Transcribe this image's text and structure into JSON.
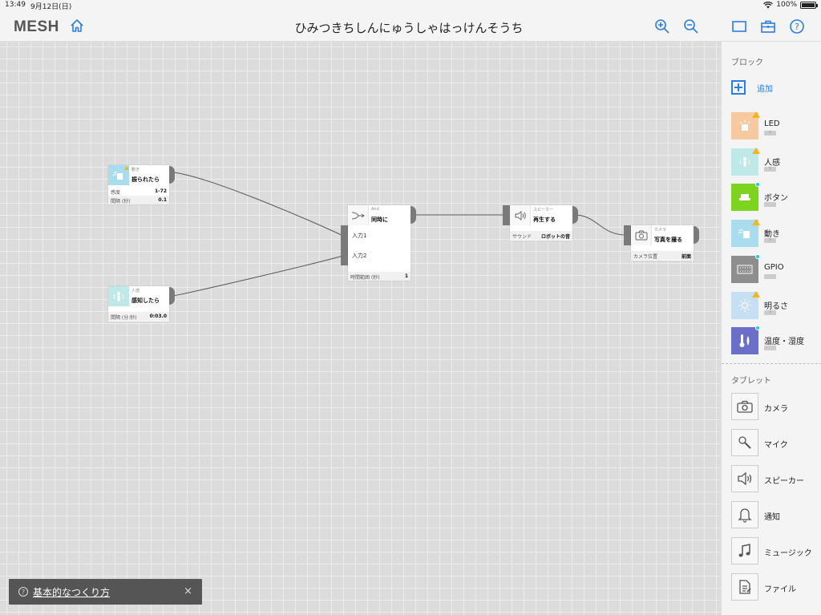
{
  "status": {
    "time": "13:49",
    "date": "9月12日(日)",
    "battery": "100%"
  },
  "header": {
    "logo": "MESH",
    "title": "ひみつきちしんにゅうしゃはっけんそうち"
  },
  "canvas": {
    "nodes": {
      "motion": {
        "small": "動き",
        "main": "振られたら",
        "row1_label": "感度",
        "row1_value": "1-72",
        "row2_label": "間隔 (秒)",
        "row2_value": "0.1"
      },
      "human": {
        "small": "人感",
        "main": "感知したら",
        "row1_label": "間隔 (分:秒)",
        "row1_value": "0:03.0"
      },
      "and": {
        "small": "And",
        "main": "同時に",
        "in1": "入力1",
        "in2": "入力2",
        "row1_label": "時間範囲 (秒)",
        "row1_value": "1"
      },
      "speaker": {
        "small": "スピーカー",
        "main": "再生する",
        "row1_label": "サウンド",
        "row1_value": "ロボットの音"
      },
      "camera": {
        "small": "カメラ",
        "main": "写真を撮る",
        "row1_label": "カメラ位置",
        "row1_value": "前面"
      }
    }
  },
  "sidebar": {
    "blocks_label": "ブロック",
    "add_label": "追加",
    "blocks": [
      {
        "name": "LED",
        "sub": "?",
        "color": "#f7c9a1",
        "badge": "warn",
        "icon": "led-icon"
      },
      {
        "name": "人感",
        "sub": "?",
        "color": "#bfe9e8",
        "badge": "warn",
        "icon": "human-sensor-icon"
      },
      {
        "name": "ボタン",
        "sub": "",
        "color": "#7ed321",
        "badge": "dot",
        "icon": "button-icon"
      },
      {
        "name": "動き",
        "sub": "?",
        "color": "#a9dced",
        "badge": "warn",
        "icon": "motion-icon"
      },
      {
        "name": "GPIO",
        "sub": "",
        "color": "#8e8e8e",
        "badge": "dot",
        "icon": "gpio-icon"
      },
      {
        "name": "明るさ",
        "sub": "?",
        "color": "#c6dff2",
        "badge": "warn",
        "icon": "brightness-icon"
      },
      {
        "name": "温度・湿度",
        "sub": "",
        "color": "#6c6fc8",
        "badge": "dot",
        "icon": "thermometer-icon"
      }
    ],
    "tablet_label": "タブレット",
    "tablet": [
      {
        "name": "カメラ",
        "icon": "camera-icon"
      },
      {
        "name": "マイク",
        "icon": "microphone-icon"
      },
      {
        "name": "スピーカー",
        "icon": "speaker-icon"
      },
      {
        "name": "通知",
        "icon": "bell-icon"
      },
      {
        "name": "ミュージック",
        "icon": "music-icon"
      },
      {
        "name": "ファイル",
        "icon": "file-icon"
      }
    ]
  },
  "help": {
    "label": "基本的なつくり方",
    "close": "×"
  },
  "colors": {
    "accent": "#2a7de1",
    "warning": "#f3b51b",
    "connected": "#1bc8f0"
  }
}
